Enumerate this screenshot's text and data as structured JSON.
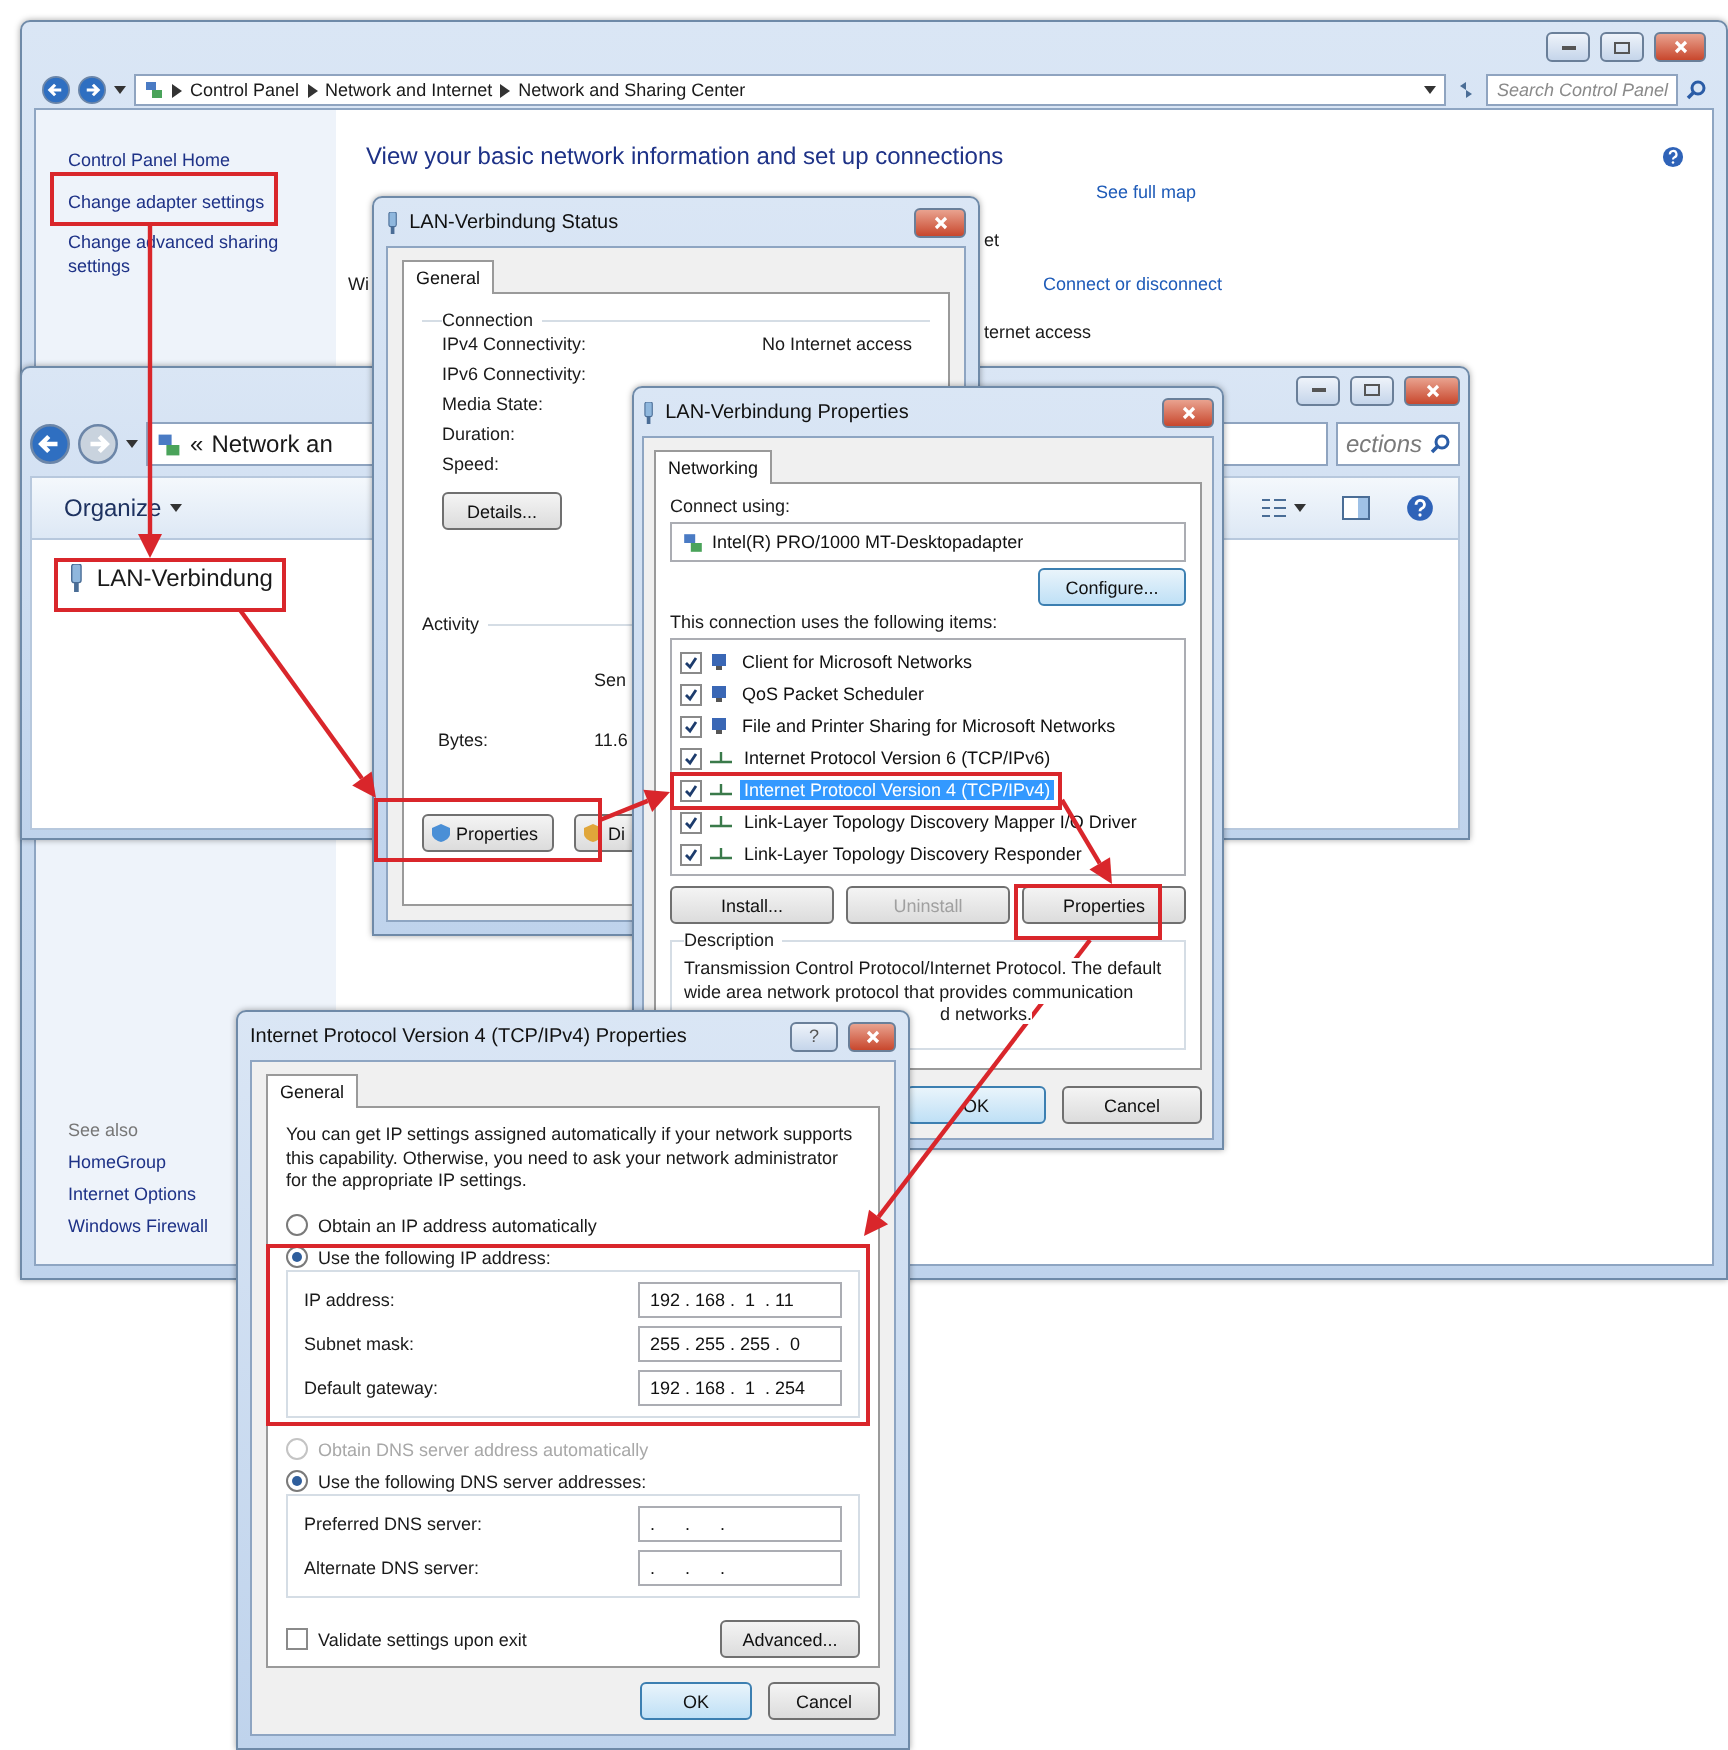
{
  "network_center": {
    "breadcrumb": [
      "Control Panel",
      "Network and Internet",
      "Network and Sharing Center"
    ],
    "search": {
      "placeholder": "Search Control Panel"
    },
    "sidebar": {
      "links": [
        "Control Panel Home",
        "Change adapter settings",
        "Change advanced sharing settings"
      ],
      "see_also_title": "See also",
      "see_also": [
        "HomeGroup",
        "Internet Options",
        "Windows Firewall"
      ]
    },
    "heading": "View your basic network information and set up connections",
    "see_full_map": "See full map",
    "connect_link": "Connect or disconnect",
    "fragments": [
      "et",
      "Wi",
      "ternet access"
    ]
  },
  "network_connections": {
    "address_chevron": "«",
    "address": "Network an",
    "search": {
      "placeholder": "ections"
    },
    "organize": "Organize",
    "items": [
      "LAN-Verbindung"
    ]
  },
  "status_dialog": {
    "title": "LAN-Verbindung Status",
    "tabs": [
      {
        "label": "General",
        "selected": true
      }
    ],
    "connection": {
      "title": "Connection",
      "rows": [
        {
          "label": "IPv4 Connectivity:",
          "value": "No Internet access"
        },
        {
          "label": "IPv6 Connectivity:"
        },
        {
          "label": "Media State:"
        },
        {
          "label": "Duration:"
        },
        {
          "label": "Speed:"
        }
      ]
    },
    "details_button": "Details...",
    "activity": {
      "title": "Activity",
      "sent": "Sen",
      "bytes_label": "Bytes:",
      "bytes_value": "11.6"
    },
    "buttons": [
      "Properties",
      "Di"
    ]
  },
  "properties_dialog": {
    "title": "LAN-Verbindung Properties",
    "tabs": [
      {
        "label": "Networking",
        "selected": true
      }
    ],
    "connect_using": "Connect using:",
    "adapter": "Intel(R) PRO/1000 MT-Desktopadapter",
    "configure": "Configure...",
    "items_label": "This connection uses the following items:",
    "items": [
      {
        "label": "Client for Microsoft Networks",
        "checked": true,
        "selected": false
      },
      {
        "label": "QoS Packet Scheduler",
        "checked": true,
        "selected": false
      },
      {
        "label": "File and Printer Sharing for Microsoft Networks",
        "checked": true,
        "selected": false
      },
      {
        "label": "Internet Protocol Version 6 (TCP/IPv6)",
        "checked": true,
        "selected": false
      },
      {
        "label": "Internet Protocol Version 4 (TCP/IPv4)",
        "checked": true,
        "selected": true
      },
      {
        "label": "Link-Layer Topology Discovery Mapper I/O Driver",
        "checked": true,
        "selected": false
      },
      {
        "label": "Link-Layer Topology Discovery Responder",
        "checked": true,
        "selected": false
      }
    ],
    "buttons": [
      {
        "label": "Install...",
        "disabled": false
      },
      {
        "label": "Uninstall",
        "disabled": true
      },
      {
        "label": "Properties",
        "disabled": false
      }
    ],
    "description": {
      "title": "Description",
      "text": "Transmission Control Protocol/Internet Protocol. The default wide area network protocol that provides communication",
      "fragment": "d networks."
    },
    "footer": [
      "OK",
      "Cancel"
    ]
  },
  "ipv4_dialog": {
    "title": "Internet Protocol Version 4 (TCP/IPv4) Properties",
    "help_button": "?",
    "tabs": [
      {
        "label": "General",
        "selected": true
      }
    ],
    "intro": "You can get IP settings assigned automatically if your network supports this capability. Otherwise, you need to ask your network administrator for the appropriate IP settings.",
    "ip_modes": [
      {
        "label": "Obtain an IP address automatically",
        "selected": false,
        "disabled": false
      },
      {
        "label": "Use the following IP address:",
        "selected": true,
        "disabled": false
      }
    ],
    "ip_fields": [
      {
        "label": "IP address:",
        "value": "192 . 168 .  1  . 11"
      },
      {
        "label": "Subnet mask:",
        "value": "255 . 255 . 255 .  0"
      },
      {
        "label": "Default gateway:",
        "value": "192 . 168 .  1  . 254"
      }
    ],
    "dns_modes": [
      {
        "label": "Obtain DNS server address automatically",
        "selected": false,
        "disabled": true
      },
      {
        "label": "Use the following DNS server addresses:",
        "selected": true,
        "disabled": false
      }
    ],
    "dns_fields": [
      {
        "label": "Preferred DNS server:",
        "value": ".      .      ."
      },
      {
        "label": "Alternate DNS server:",
        "value": ".      .      ."
      }
    ],
    "validate": {
      "label": "Validate settings upon exit",
      "checked": false
    },
    "advanced": "Advanced...",
    "footer": [
      "OK",
      "Cancel"
    ]
  }
}
